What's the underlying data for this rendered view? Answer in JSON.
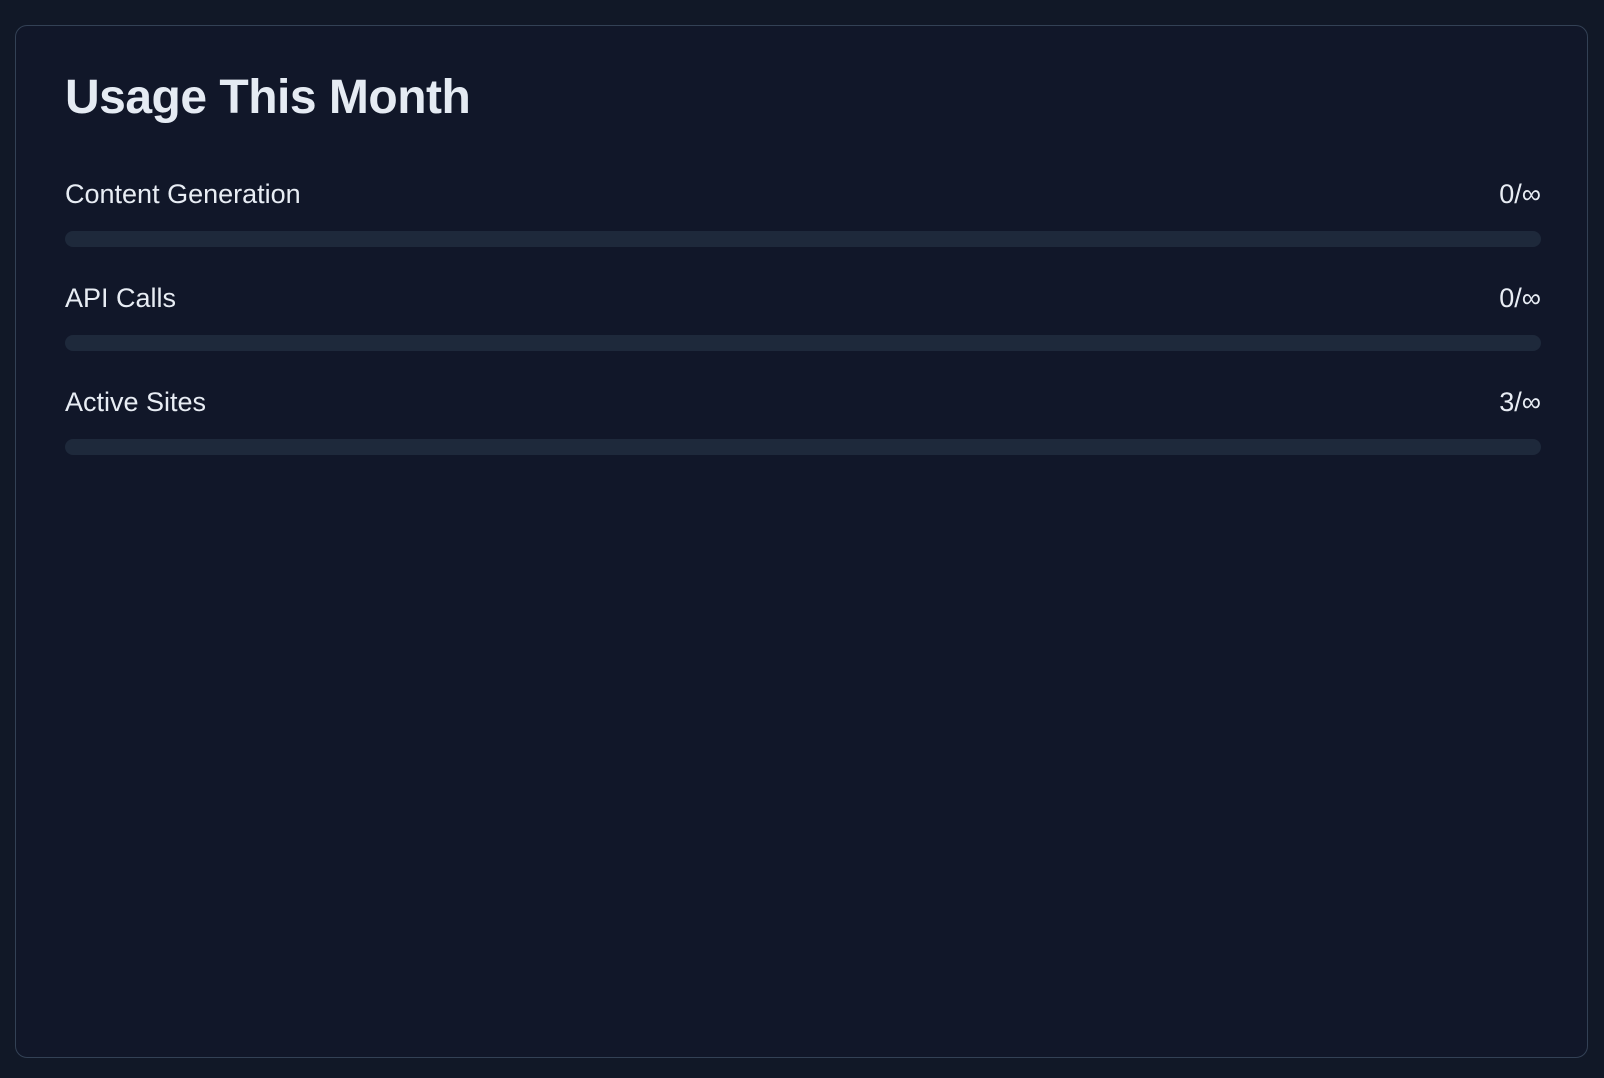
{
  "usage": {
    "title": "Usage This Month",
    "items": [
      {
        "label": "Content Generation",
        "value": "0/∞",
        "progress": 0
      },
      {
        "label": "API Calls",
        "value": "0/∞",
        "progress": 0
      },
      {
        "label": "Active Sites",
        "value": "3/∞",
        "progress": 0
      }
    ]
  },
  "colors": {
    "background": "#111827",
    "card_border": "#334155",
    "track": "#1e293b",
    "text": "#e8edf4"
  }
}
